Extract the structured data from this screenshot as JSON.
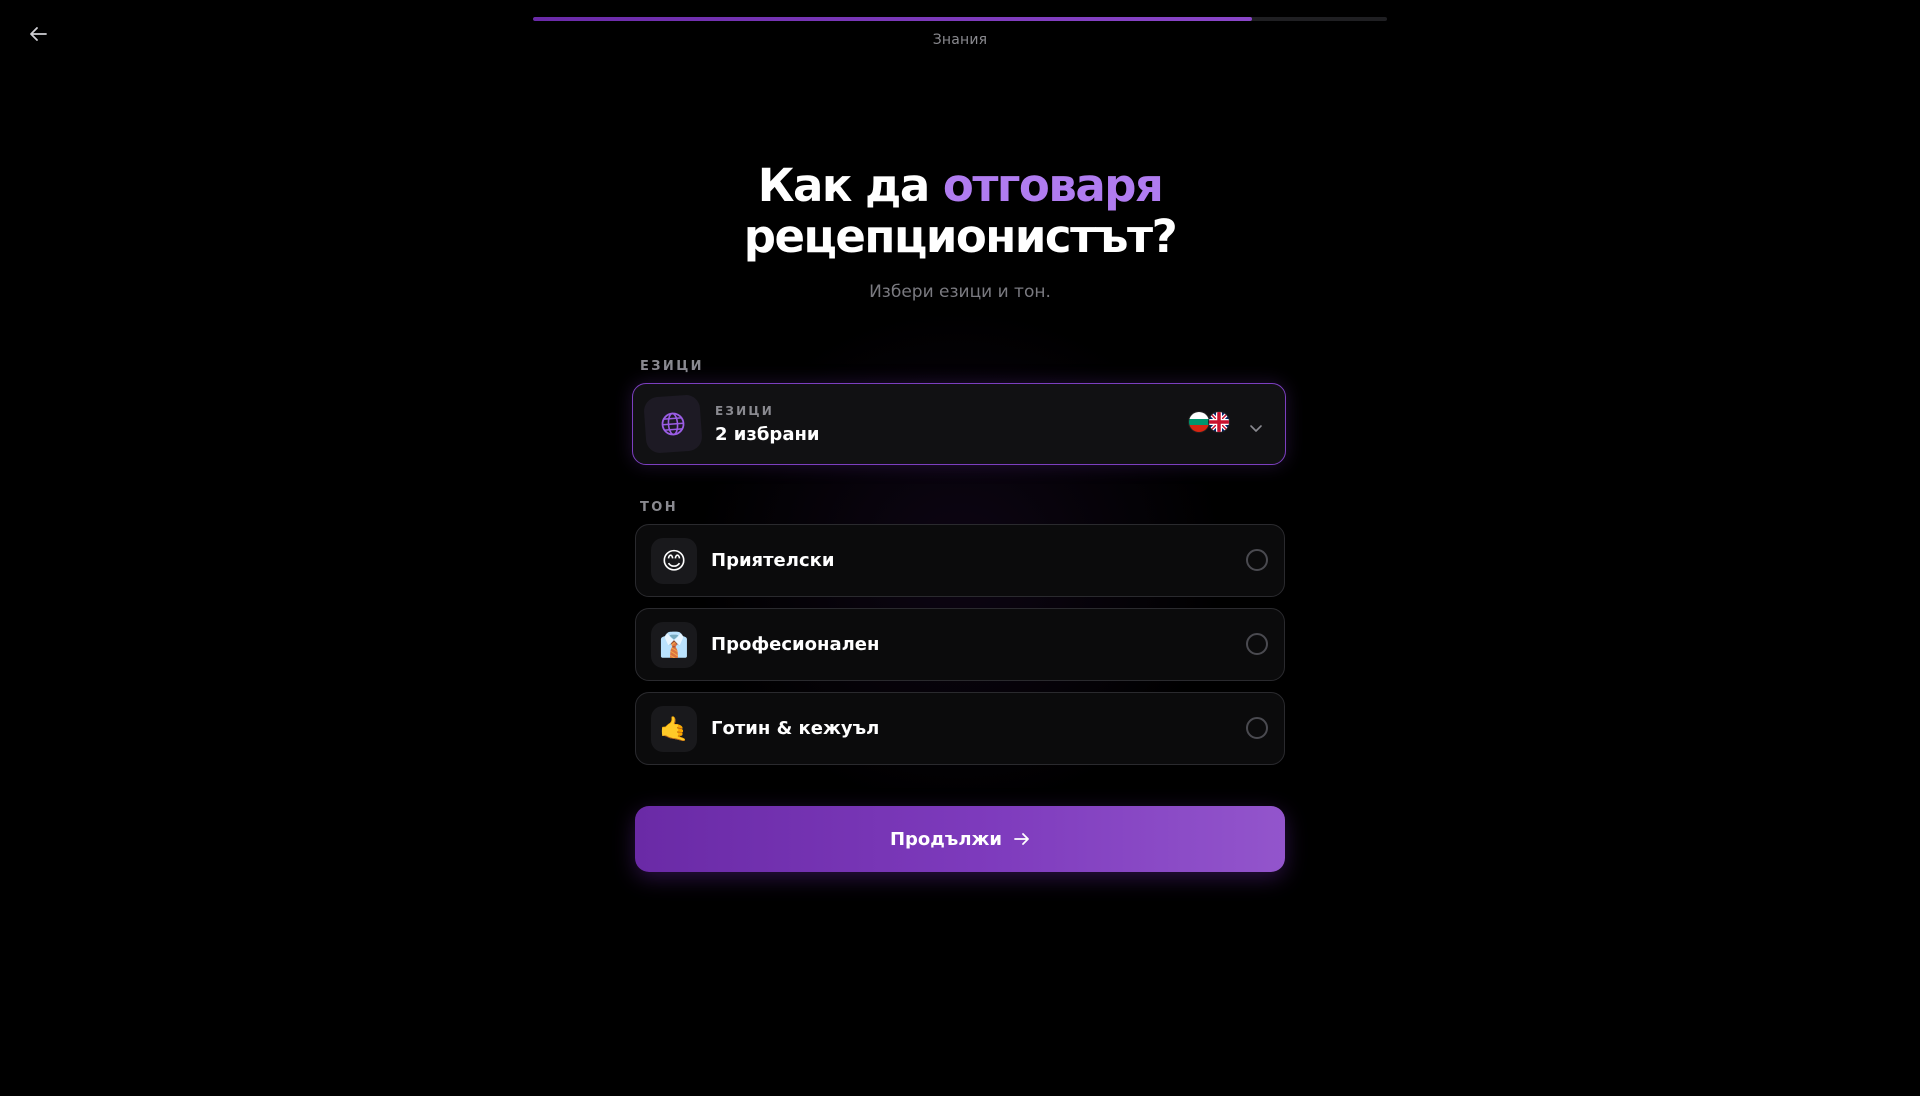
{
  "progress": {
    "label": "Знания",
    "fraction": 0.842
  },
  "title": {
    "part1": "Как да ",
    "accent": "отговаря",
    "part2": "рецепционистът?"
  },
  "subtitle": "Избери езици и тон.",
  "languages_section": {
    "label": "ЕЗИЦИ",
    "select_label": "ЕЗИЦИ",
    "select_value": "2 избрани",
    "flags": [
      "bulgaria-flag-icon",
      "uk-flag-icon"
    ]
  },
  "tone_section": {
    "label": "ТОН",
    "options": [
      {
        "emoji": "😊",
        "label": "Приятелски",
        "selected": false
      },
      {
        "emoji": "👔",
        "label": "Професионален",
        "selected": false
      },
      {
        "emoji": "🤙",
        "label": "Готин & кежуъл",
        "selected": false
      }
    ]
  },
  "continue_button": {
    "label": "Продължи"
  },
  "colors": {
    "accent": "#b07cf0",
    "button": "#7e3bbd",
    "select_border": "#7c3fc0"
  }
}
